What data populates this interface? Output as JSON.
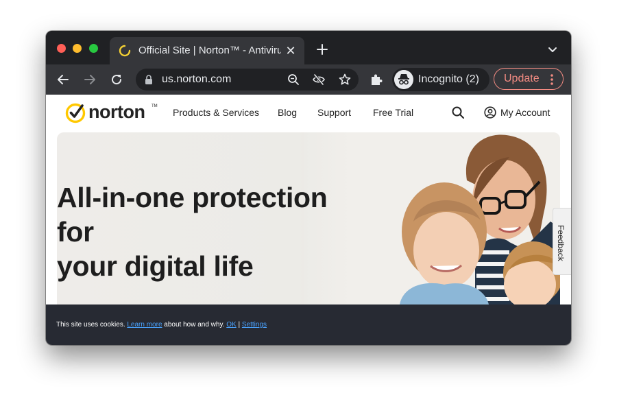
{
  "browser": {
    "tab": {
      "title": "Official Site | Norton™ - Antivirus",
      "close_glyph": "✕"
    },
    "address_bar": {
      "url": "us.norton.com"
    },
    "profile": {
      "label": "Incognito (2)"
    },
    "update_button": {
      "label": "Update"
    },
    "colors": {
      "frame": "#202124",
      "toolbar": "#35363a",
      "update_accent": "#f28b82"
    }
  },
  "site": {
    "logo": {
      "text": "norton",
      "tm": "TM"
    },
    "nav": {
      "items": [
        "Products & Services",
        "Blog",
        "Support",
        "Free Trial"
      ],
      "account_label": "My Account"
    },
    "hero": {
      "headline_lines": [
        "All-in-one protection",
        "for",
        "your digital life"
      ]
    },
    "feedback_tab": {
      "label": "Feedback"
    },
    "cookie_banner": {
      "prefix": "This site uses cookies. ",
      "learn_more": "Learn more",
      "middle": " about how and why. ",
      "ok": "OK",
      "separator": " | ",
      "settings": "Settings"
    },
    "colors": {
      "brand_yellow": "#ffc800",
      "banner_bg": "#272a33",
      "link": "#4aa3ff"
    }
  }
}
